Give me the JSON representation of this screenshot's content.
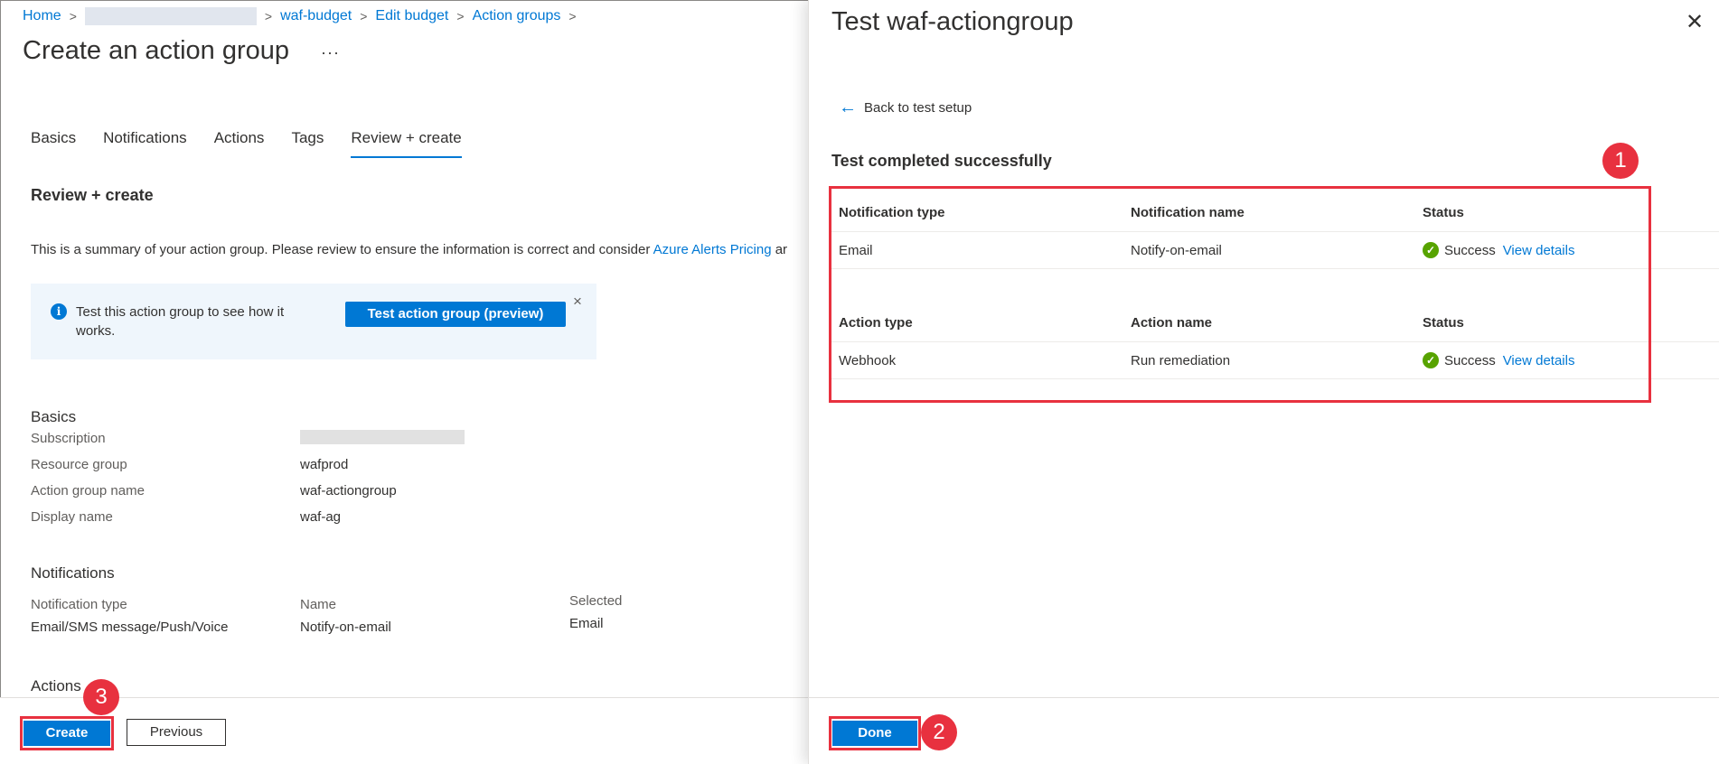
{
  "breadcrumb": {
    "home": "Home",
    "budget": "waf-budget",
    "edit": "Edit budget",
    "groups": "Action groups"
  },
  "page": {
    "title": "Create an action group",
    "more": "···"
  },
  "tabs": [
    "Basics",
    "Notifications",
    "Actions",
    "Tags",
    "Review + create"
  ],
  "active_tab": "Review + create",
  "review": {
    "title": "Review + create",
    "summary_text": "This is a summary of your action group. Please review to ensure the information is correct and consider ",
    "summary_link": "Azure Alerts Pricing",
    "summary_tail": " ar"
  },
  "infobox": {
    "text": "Test this action group to see how it works.",
    "button": "Test action group (preview)",
    "close": "×"
  },
  "basics": {
    "heading": "Basics",
    "subscription_label": "Subscription",
    "resource_group_label": "Resource group",
    "resource_group": "wafprod",
    "name_label": "Action group name",
    "name": "waf-actiongroup",
    "display_label": "Display name",
    "display": "waf-ag"
  },
  "notifications": {
    "heading": "Notifications",
    "type_label": "Notification type",
    "type_value": "Email/SMS message/Push/Voice",
    "name_label": "Name",
    "name_value": "Notify-on-email",
    "selected_label": "Selected",
    "selected_value": "Email"
  },
  "actions": {
    "heading": "Actions"
  },
  "footer": {
    "create": "Create",
    "previous": "Previous"
  },
  "panel": {
    "title": "Test waf-actiongroup",
    "close": "✕",
    "back": "Back to test setup",
    "status": "Test completed successfully",
    "done": "Done"
  },
  "notif_table": {
    "headers": [
      "Notification type",
      "Notification name",
      "Status"
    ],
    "row": [
      "Email",
      "Notify-on-email",
      "Success"
    ],
    "link": "View details"
  },
  "action_table": {
    "headers": [
      "Action type",
      "Action name",
      "Status"
    ],
    "row": [
      "Webhook",
      "Run remediation",
      "Success"
    ],
    "link": "View details"
  },
  "badges": [
    "1",
    "2",
    "3"
  ],
  "colors": {
    "accent": "#0078d4",
    "highlight": "#e8313f",
    "success": "#57a300"
  }
}
